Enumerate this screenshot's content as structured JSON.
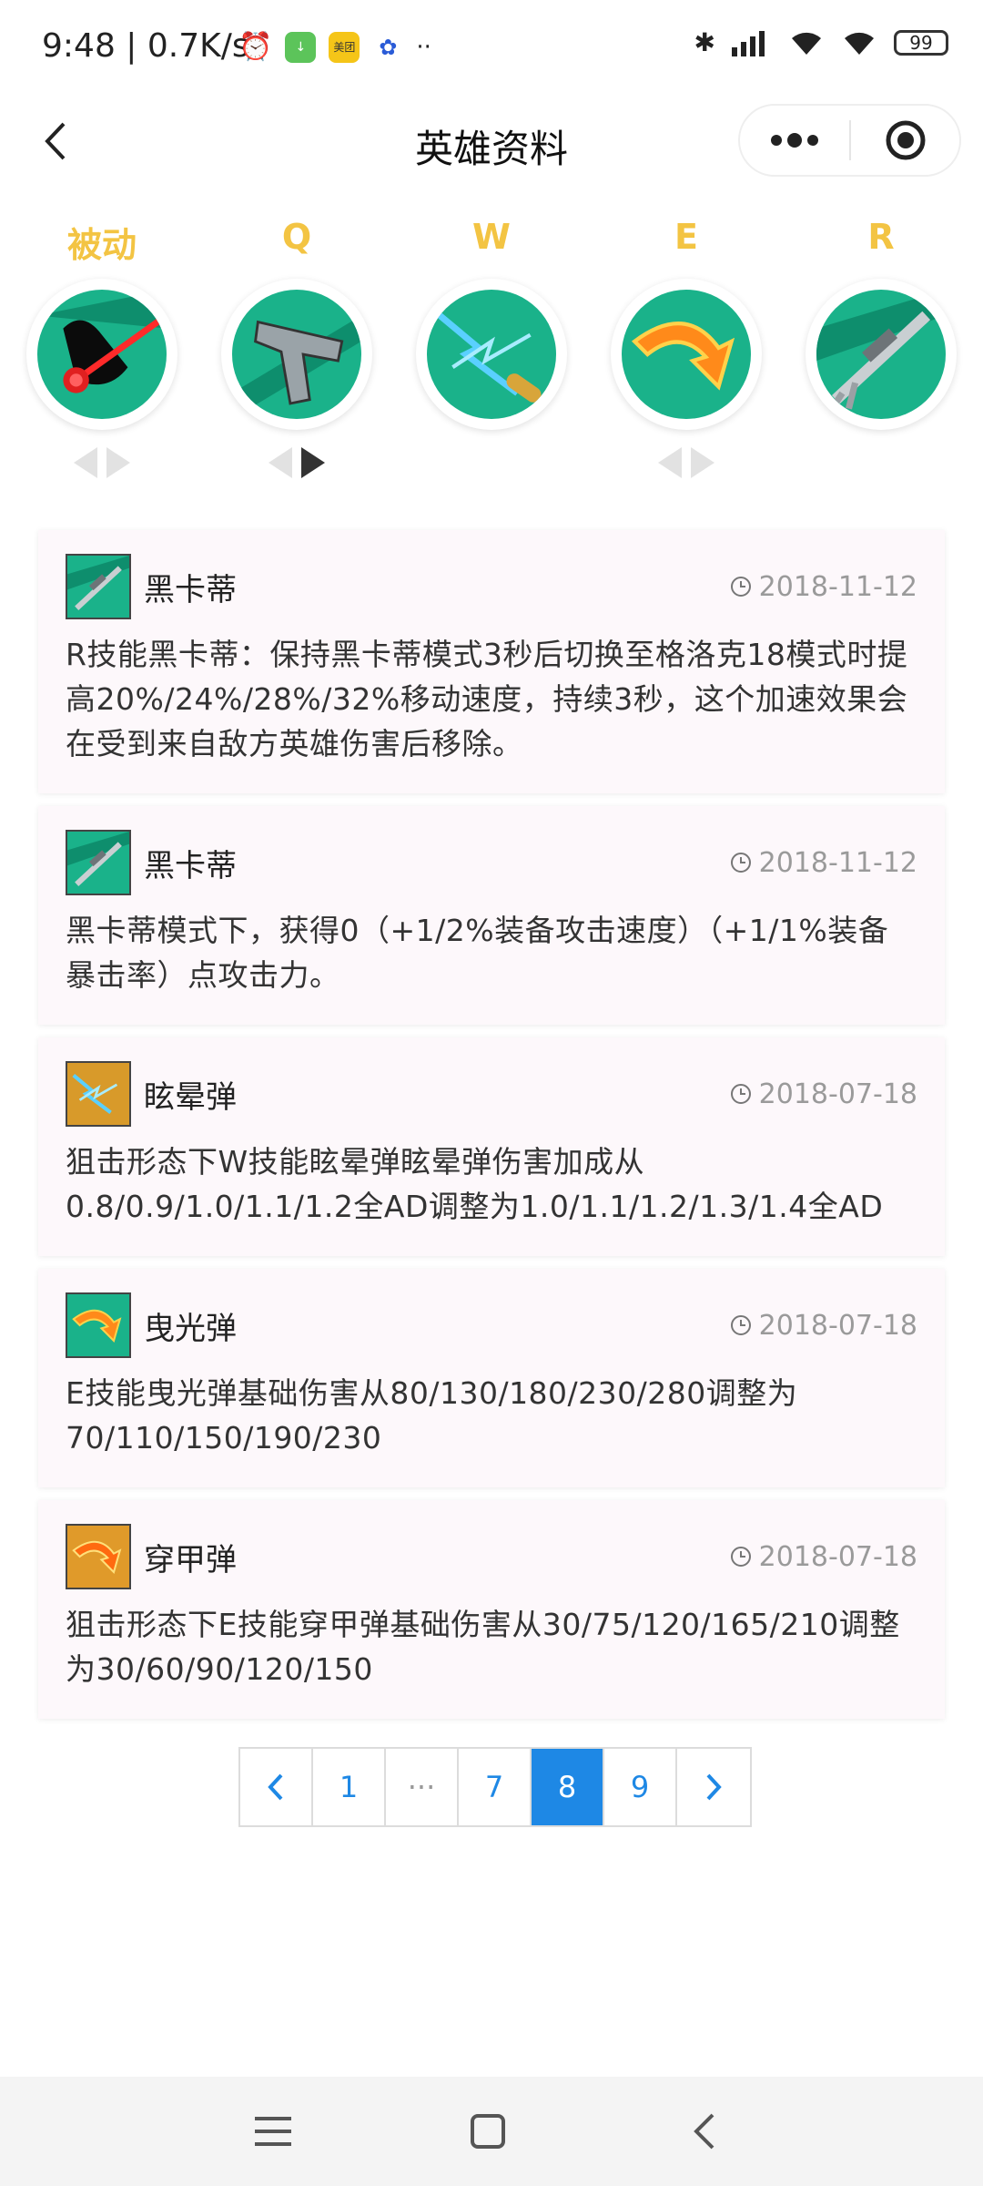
{
  "status_bar": {
    "time": "9:48",
    "speed": "0.7K/s",
    "battery": "99",
    "app_icons": [
      {
        "name": "download-app-icon",
        "color": "#5cc45a",
        "glyph": "↓"
      },
      {
        "name": "meituan-app-icon",
        "color": "#f5c518",
        "glyph": "美团"
      },
      {
        "name": "baidu-app-icon",
        "color": "#ffffff",
        "glyph": "🐾"
      }
    ]
  },
  "nav": {
    "title": "英雄资料"
  },
  "skills": [
    {
      "key": "被动",
      "icon": "laser-sight-icon",
      "arrows": true,
      "right_active": false
    },
    {
      "key": "Q",
      "icon": "pistol-icon",
      "arrows": true,
      "right_active": true
    },
    {
      "key": "W",
      "icon": "stun-bullet-icon",
      "arrows": false,
      "right_active": false
    },
    {
      "key": "E",
      "icon": "tracer-bullet-icon",
      "arrows": true,
      "right_active": false
    },
    {
      "key": "R",
      "icon": "sniper-rifle-icon",
      "arrows": false,
      "right_active": false
    }
  ],
  "updates": [
    {
      "name": "黑卡蒂",
      "date": "2018-11-12",
      "icon": "sniper-rifle-icon",
      "desc": "R技能黑卡蒂：保持黑卡蒂模式3秒后切换至格洛克18模式时提高20%/24%/28%/32%移动速度，持续3秒，这个加速效果会在受到来自敌方英雄伤害后移除。"
    },
    {
      "name": "黑卡蒂",
      "date": "2018-11-12",
      "icon": "sniper-rifle-icon",
      "desc": "黑卡蒂模式下，获得0（+1/2%装备攻击速度）（+1/1%装备暴击率）点攻击力。"
    },
    {
      "name": "眩晕弹",
      "date": "2018-07-18",
      "icon": "stun-bullet-icon",
      "desc": "狙击形态下W技能眩晕弹眩晕弹伤害加成从0.8/0.9/1.0/1.1/1.2全AD调整为1.0/1.1/1.2/1.3/1.4全AD"
    },
    {
      "name": "曳光弹",
      "date": "2018-07-18",
      "icon": "tracer-bullet-icon",
      "desc": "E技能曳光弹基础伤害从80/130/180/230/280调整为70/110/150/190/230"
    },
    {
      "name": "穿甲弹",
      "date": "2018-07-18",
      "icon": "armor-pierce-icon",
      "desc": "狙击形态下E技能穿甲弹基础伤害从30/75/120/165/210调整为30/60/90/120/150"
    }
  ],
  "pagination": {
    "pages": [
      "1",
      "···",
      "7",
      "8",
      "9"
    ],
    "current": "8"
  },
  "colors": {
    "accent": "#1e88e5",
    "skill_key": "#f3c443",
    "card_bg": "#fdf8fb"
  }
}
